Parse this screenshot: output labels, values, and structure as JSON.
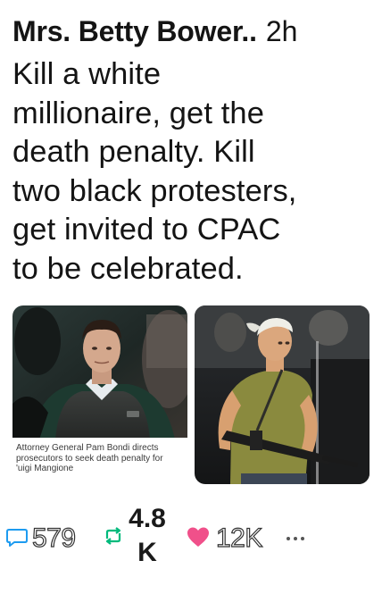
{
  "post": {
    "author": "Mrs. Betty Bower..",
    "time_ago": "2h",
    "text_lines": [
      "Kill a white",
      "millionaire, get the",
      "death penalty. Kill",
      "two black protesters,",
      "get invited to CPAC",
      "to be celebrated."
    ],
    "media": [
      {
        "caption_lines": [
          "Attorney General Pam Bondi directs",
          "prosecutors to seek death penalty for",
          "'uigi Mangione"
        ]
      },
      {}
    ]
  },
  "actions": {
    "comments": "579",
    "reposts_line1": "4.8",
    "reposts_line2": "K",
    "likes": "12K",
    "colors": {
      "comment": "#1d9bf0",
      "repost": "#00ba7c",
      "like": "#f0508a"
    },
    "icons": [
      "comment-icon",
      "repost-icon",
      "heart-icon",
      "more-icon"
    ]
  }
}
